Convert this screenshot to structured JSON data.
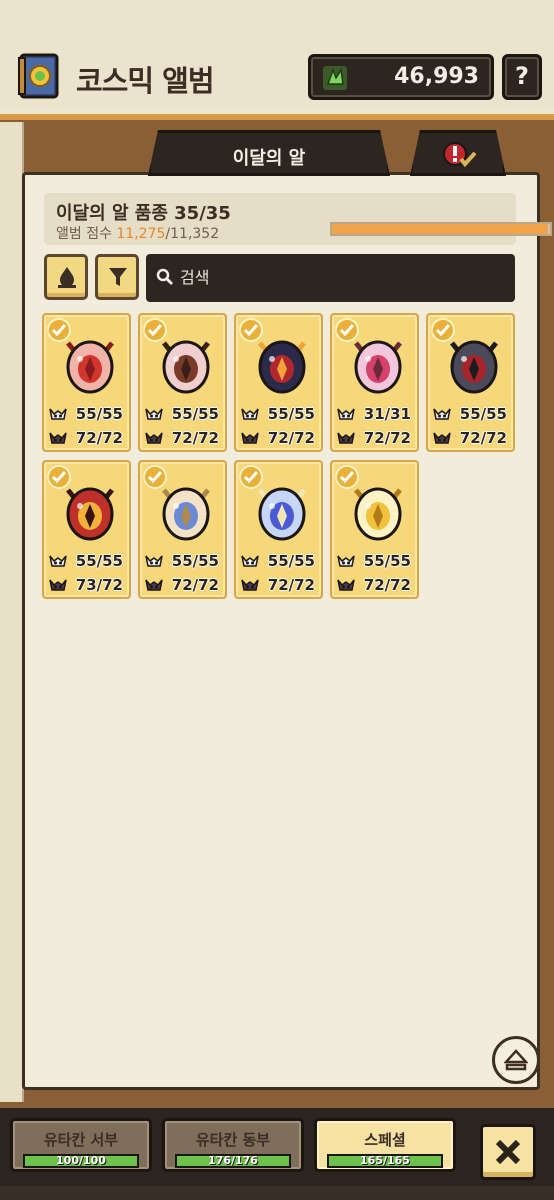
{
  "header": {
    "title": "코스믹 앨범",
    "currency_amount": "46,993",
    "help_label": "?",
    "book_icon": "album-book-icon",
    "gem_icon": "green-gem-icon"
  },
  "tabs": {
    "main_label": "이달의 알",
    "alt_icon": "alert-check-icon"
  },
  "summary": {
    "breed_label": "이달의 알 품종 35/35",
    "score_prefix": "앨범 점수 ",
    "score_current": "11,275",
    "score_total": "/11,352",
    "progress_fraction": 0.993
  },
  "toolbar": {
    "sort_icon": "sort-icon",
    "filter_icon": "filter-icon",
    "search_placeholder": "검색"
  },
  "colors": {
    "card_bg": "#f6d77a",
    "progress_fill": "#f0a34a",
    "score_highlight": "#e48a2a",
    "dark_panel": "#2c2520"
  },
  "cards": [
    {
      "egg": "pink-red-egg",
      "stat1": "55/55",
      "stat2": "72/72",
      "c1": "#f3b3a8",
      "c2": "#d2352e",
      "c3": "#8a1b1b"
    },
    {
      "egg": "pink-brown-egg",
      "stat1": "55/55",
      "stat2": "72/72",
      "c1": "#f1cfcf",
      "c2": "#7a3a2a",
      "c3": "#3a1e18"
    },
    {
      "egg": "dark-flame-egg",
      "stat1": "55/55",
      "stat2": "72/72",
      "c1": "#2c2a4a",
      "c2": "#b0282e",
      "c3": "#f2a23a"
    },
    {
      "egg": "pink-rose-egg",
      "stat1": "31/31",
      "stat2": "72/72",
      "c1": "#f3c6dc",
      "c2": "#d6406a",
      "c3": "#6a2a3a"
    },
    {
      "egg": "dark-demon-egg",
      "stat1": "55/55",
      "stat2": "72/72",
      "c1": "#4a4a5a",
      "c2": "#a8242a",
      "c3": "#1c1c24"
    },
    {
      "egg": "red-gold-egg",
      "stat1": "55/55",
      "stat2": "73/72",
      "c1": "#c0302a",
      "c2": "#f2b23a",
      "c3": "#3a1212"
    },
    {
      "egg": "cream-crystal-egg",
      "stat1": "55/55",
      "stat2": "72/72",
      "c1": "#f3e2c6",
      "c2": "#6a8ad6",
      "c3": "#b08a4a"
    },
    {
      "egg": "blue-crystal-egg",
      "stat1": "55/55",
      "stat2": "72/72",
      "c1": "#c6d6f6",
      "c2": "#4a5ad6",
      "c3": "#f2e6b6"
    },
    {
      "egg": "golden-egg",
      "stat1": "55/55",
      "stat2": "72/72",
      "c1": "#fff3c6",
      "c2": "#f2c23a",
      "c3": "#b07a1a"
    }
  ],
  "bottom_tabs": [
    {
      "label": "유타칸 서부",
      "progress": "100/100",
      "fraction": 1.0
    },
    {
      "label": "유타칸 동부",
      "progress": "176/176",
      "fraction": 1.0
    },
    {
      "label": "스페셜",
      "progress": "165/165",
      "fraction": 1.0
    }
  ],
  "close_icon": "close-x-icon",
  "eject_icon": "eject-icon"
}
